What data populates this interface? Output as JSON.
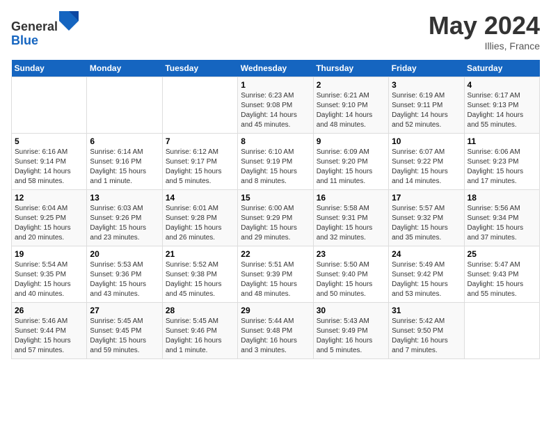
{
  "header": {
    "logo_general": "General",
    "logo_blue": "Blue",
    "month_title": "May 2024",
    "location": "Illies, France"
  },
  "weekdays": [
    "Sunday",
    "Monday",
    "Tuesday",
    "Wednesday",
    "Thursday",
    "Friday",
    "Saturday"
  ],
  "weeks": [
    [
      {
        "day": "",
        "info": ""
      },
      {
        "day": "",
        "info": ""
      },
      {
        "day": "",
        "info": ""
      },
      {
        "day": "1",
        "info": "Sunrise: 6:23 AM\nSunset: 9:08 PM\nDaylight: 14 hours and 45 minutes."
      },
      {
        "day": "2",
        "info": "Sunrise: 6:21 AM\nSunset: 9:10 PM\nDaylight: 14 hours and 48 minutes."
      },
      {
        "day": "3",
        "info": "Sunrise: 6:19 AM\nSunset: 9:11 PM\nDaylight: 14 hours and 52 minutes."
      },
      {
        "day": "4",
        "info": "Sunrise: 6:17 AM\nSunset: 9:13 PM\nDaylight: 14 hours and 55 minutes."
      }
    ],
    [
      {
        "day": "5",
        "info": "Sunrise: 6:16 AM\nSunset: 9:14 PM\nDaylight: 14 hours and 58 minutes."
      },
      {
        "day": "6",
        "info": "Sunrise: 6:14 AM\nSunset: 9:16 PM\nDaylight: 15 hours and 1 minute."
      },
      {
        "day": "7",
        "info": "Sunrise: 6:12 AM\nSunset: 9:17 PM\nDaylight: 15 hours and 5 minutes."
      },
      {
        "day": "8",
        "info": "Sunrise: 6:10 AM\nSunset: 9:19 PM\nDaylight: 15 hours and 8 minutes."
      },
      {
        "day": "9",
        "info": "Sunrise: 6:09 AM\nSunset: 9:20 PM\nDaylight: 15 hours and 11 minutes."
      },
      {
        "day": "10",
        "info": "Sunrise: 6:07 AM\nSunset: 9:22 PM\nDaylight: 15 hours and 14 minutes."
      },
      {
        "day": "11",
        "info": "Sunrise: 6:06 AM\nSunset: 9:23 PM\nDaylight: 15 hours and 17 minutes."
      }
    ],
    [
      {
        "day": "12",
        "info": "Sunrise: 6:04 AM\nSunset: 9:25 PM\nDaylight: 15 hours and 20 minutes."
      },
      {
        "day": "13",
        "info": "Sunrise: 6:03 AM\nSunset: 9:26 PM\nDaylight: 15 hours and 23 minutes."
      },
      {
        "day": "14",
        "info": "Sunrise: 6:01 AM\nSunset: 9:28 PM\nDaylight: 15 hours and 26 minutes."
      },
      {
        "day": "15",
        "info": "Sunrise: 6:00 AM\nSunset: 9:29 PM\nDaylight: 15 hours and 29 minutes."
      },
      {
        "day": "16",
        "info": "Sunrise: 5:58 AM\nSunset: 9:31 PM\nDaylight: 15 hours and 32 minutes."
      },
      {
        "day": "17",
        "info": "Sunrise: 5:57 AM\nSunset: 9:32 PM\nDaylight: 15 hours and 35 minutes."
      },
      {
        "day": "18",
        "info": "Sunrise: 5:56 AM\nSunset: 9:34 PM\nDaylight: 15 hours and 37 minutes."
      }
    ],
    [
      {
        "day": "19",
        "info": "Sunrise: 5:54 AM\nSunset: 9:35 PM\nDaylight: 15 hours and 40 minutes."
      },
      {
        "day": "20",
        "info": "Sunrise: 5:53 AM\nSunset: 9:36 PM\nDaylight: 15 hours and 43 minutes."
      },
      {
        "day": "21",
        "info": "Sunrise: 5:52 AM\nSunset: 9:38 PM\nDaylight: 15 hours and 45 minutes."
      },
      {
        "day": "22",
        "info": "Sunrise: 5:51 AM\nSunset: 9:39 PM\nDaylight: 15 hours and 48 minutes."
      },
      {
        "day": "23",
        "info": "Sunrise: 5:50 AM\nSunset: 9:40 PM\nDaylight: 15 hours and 50 minutes."
      },
      {
        "day": "24",
        "info": "Sunrise: 5:49 AM\nSunset: 9:42 PM\nDaylight: 15 hours and 53 minutes."
      },
      {
        "day": "25",
        "info": "Sunrise: 5:47 AM\nSunset: 9:43 PM\nDaylight: 15 hours and 55 minutes."
      }
    ],
    [
      {
        "day": "26",
        "info": "Sunrise: 5:46 AM\nSunset: 9:44 PM\nDaylight: 15 hours and 57 minutes."
      },
      {
        "day": "27",
        "info": "Sunrise: 5:45 AM\nSunset: 9:45 PM\nDaylight: 15 hours and 59 minutes."
      },
      {
        "day": "28",
        "info": "Sunrise: 5:45 AM\nSunset: 9:46 PM\nDaylight: 16 hours and 1 minute."
      },
      {
        "day": "29",
        "info": "Sunrise: 5:44 AM\nSunset: 9:48 PM\nDaylight: 16 hours and 3 minutes."
      },
      {
        "day": "30",
        "info": "Sunrise: 5:43 AM\nSunset: 9:49 PM\nDaylight: 16 hours and 5 minutes."
      },
      {
        "day": "31",
        "info": "Sunrise: 5:42 AM\nSunset: 9:50 PM\nDaylight: 16 hours and 7 minutes."
      },
      {
        "day": "",
        "info": ""
      }
    ]
  ]
}
